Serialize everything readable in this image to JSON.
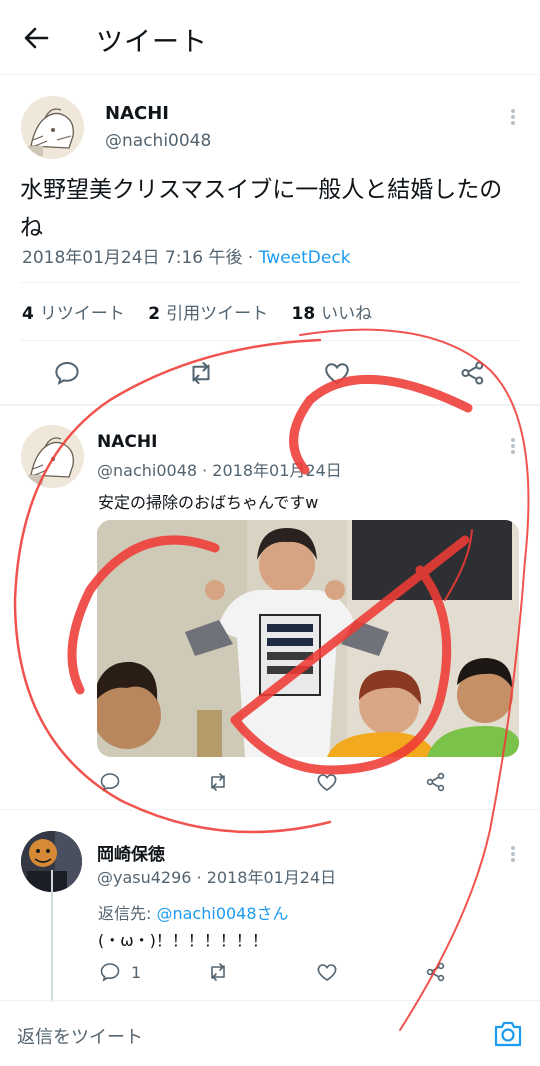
{
  "header": {
    "title": "ツイート",
    "back_icon": "arrow-left-icon"
  },
  "main_tweet": {
    "name": "NACHI",
    "handle": "@nachi0048",
    "text": "水野望美クリスマスイブに一般人と結婚したのね",
    "timestamp": "2018年01月24日 7:16 午後 · ",
    "source": "TweetDeck",
    "stats": {
      "retweets_count": "4",
      "retweets_label": "リツイート",
      "quotes_count": "2",
      "quotes_label": "引用ツイート",
      "likes_count": "18",
      "likes_label": "いいね"
    }
  },
  "reply_1": {
    "name": "NACHI",
    "handle_date": "@nachi0048 · 2018年01月24日",
    "text": "安定の掃除のおばちゃんですw"
  },
  "reply_2": {
    "name": "岡崎保徳",
    "handle_date": "@yasu4296 · 2018年01月24日",
    "reply_to_label": "返信先: ",
    "reply_to_handle": "@nachi0048さん",
    "text": "(・ω・)！！！！！！！",
    "reply_count": "1"
  },
  "compose": {
    "placeholder": "返信をツイート",
    "camera_icon": "camera-icon"
  },
  "colors": {
    "accent": "#1d9bf0",
    "secondary_text": "#536471",
    "annotation": "#ef3b36"
  }
}
